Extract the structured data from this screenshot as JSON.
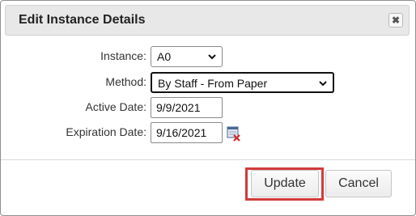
{
  "dialog": {
    "title": "Edit Instance Details",
    "close_icon": "close-icon"
  },
  "form": {
    "instance": {
      "label": "Instance:",
      "value": "A0"
    },
    "method": {
      "label": "Method:",
      "value": "By Staff - From Paper"
    },
    "active_date": {
      "label": "Active Date:",
      "value": "9/9/2021"
    },
    "expiration_date": {
      "label": "Expiration Date:",
      "value": "9/16/2021",
      "clear_icon": "calendar-clear-icon"
    }
  },
  "buttons": {
    "update": "Update",
    "cancel": "Cancel"
  },
  "colors": {
    "highlight": "#d43a3a",
    "titlebar": "#e8e8e8"
  }
}
